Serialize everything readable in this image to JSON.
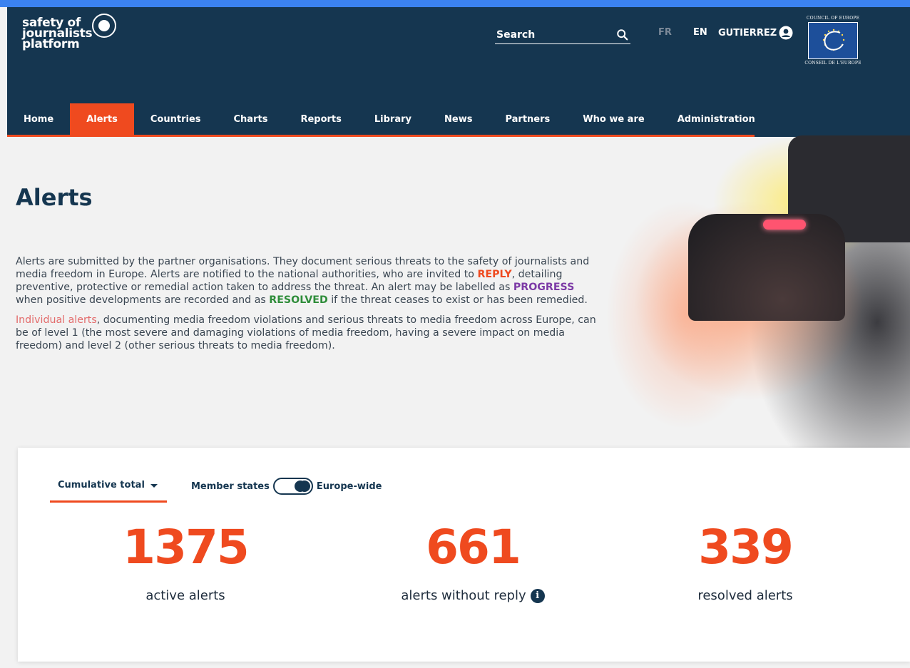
{
  "brand": {
    "logo_lines": [
      "safety of",
      "journalists",
      "platform"
    ],
    "coe_top": "COUNCIL OF EUROPE",
    "coe_bottom": "CONSEIL DE L'EUROPE"
  },
  "header": {
    "search_placeholder": "Search",
    "lang_fr": "FR",
    "lang_en": "EN",
    "user_name": "GUTIERREZ"
  },
  "nav": {
    "items": [
      {
        "label": "Home"
      },
      {
        "label": "Alerts",
        "active": true
      },
      {
        "label": "Countries"
      },
      {
        "label": "Charts"
      },
      {
        "label": "Reports"
      },
      {
        "label": "Library"
      },
      {
        "label": "News"
      },
      {
        "label": "Partners"
      },
      {
        "label": "Who we are"
      },
      {
        "label": "Administration"
      }
    ]
  },
  "page": {
    "title": "Alerts",
    "intro_p1_a": "Alerts are submitted by the partner organisations. They document serious threats to the safety of journalists and media freedom in Europe. Alerts are notified to the national authorities, who are invited to ",
    "reply": "REPLY",
    "intro_p1_b": ", detailing preventive, protective or remedial action taken to address the threat. An alert may be labelled as ",
    "progress": "PROGRESS",
    "intro_p1_c": " when positive developments are recorded and as ",
    "resolved": "RESOLVED",
    "intro_p1_d": " if the threat ceases to exist or has been remedied.",
    "individual_alerts": "Individual alerts",
    "intro_p2": ", documenting media freedom violations and serious threats to media freedom across Europe, can be of level 1 (the most severe and damaging violations of media freedom, having a severe impact on media freedom) and level 2 (other serious threats to media freedom)."
  },
  "stats": {
    "dropdown_label": "Cumulative total",
    "toggle_left": "Member states",
    "toggle_right": "Europe-wide",
    "items": [
      {
        "value": "1375",
        "label": "active alerts"
      },
      {
        "value": "661",
        "label": "alerts without reply"
      },
      {
        "value": "339",
        "label": "resolved alerts"
      }
    ]
  },
  "colors": {
    "header_bg": "#153650",
    "accent": "#ef4a1f",
    "progress": "#7c3aa6",
    "resolved": "#2f8d3a"
  }
}
